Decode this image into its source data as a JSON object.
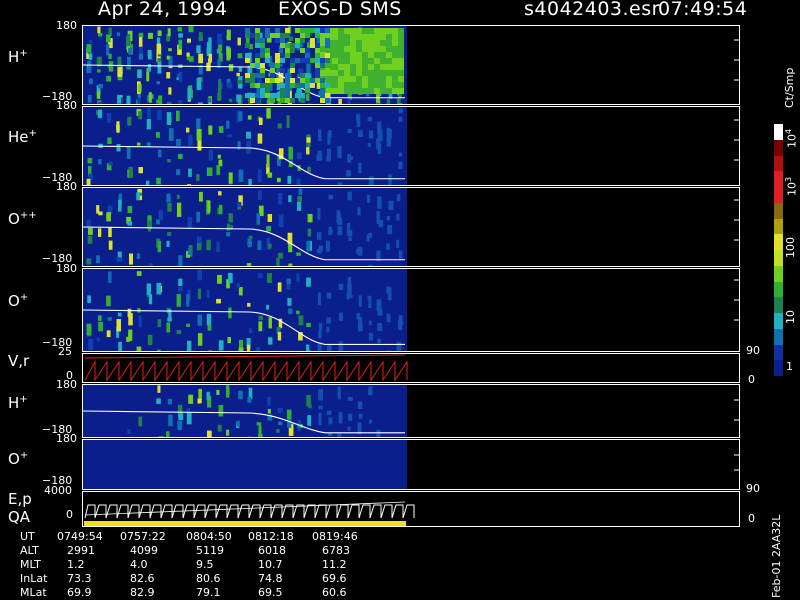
{
  "header": {
    "date": "Apr 24, 1994",
    "instrument": "EXOS-D SMS",
    "file": "s4042403.esr",
    "time": "07:49:54"
  },
  "colors": {
    "background": "#000000",
    "spectrogram_bg": "#0a1e8c",
    "frame": "#ffffff",
    "curve": "#ffffff",
    "vr_trace": "#e02020",
    "qa_bar": "#f0e020"
  },
  "colorbar": {
    "unit": "Ct/Smp",
    "tick_labels": [
      "1",
      "10",
      "100",
      "10",
      "10"
    ],
    "exponent_labels": [
      "3",
      "4"
    ],
    "colors": [
      "#ffffff",
      "#7a0000",
      "#b01010",
      "#e02020",
      "#e02020",
      "#8a6a10",
      "#b0a010",
      "#e0e030",
      "#c0e020",
      "#70d020",
      "#30b030",
      "#208050",
      "#20b0c0",
      "#1070b0",
      "#1030a0",
      "#0a1e8c"
    ]
  },
  "panels": [
    {
      "label": "H",
      "charge": "+",
      "ymax": "180",
      "ymin": "−180"
    },
    {
      "label": "He",
      "charge": "+",
      "ymax": "180",
      "ymin": "−180"
    },
    {
      "label": "O",
      "charge": "++",
      "ymax": "180",
      "ymin": "−180"
    },
    {
      "label": "O",
      "charge": "+",
      "ymax": "180",
      "ymin": "−180"
    },
    {
      "label": "V,r",
      "charge": "",
      "ymax": "25",
      "ymin": "0",
      "right_top": "90",
      "right_bottom": "0"
    },
    {
      "label": "H",
      "charge": "+",
      "ymax": "180",
      "ymin": "−180"
    },
    {
      "label": "O",
      "charge": "+",
      "ymax": "180",
      "ymin": "−180"
    },
    {
      "label": "E,p",
      "label2": "QA",
      "ymax": "4000",
      "ymin": "0",
      "right_top": "90",
      "right_bottom": "0"
    }
  ],
  "footer": {
    "row_labels": [
      "UT",
      "ALT",
      "MLT",
      "InLat",
      "MLat"
    ],
    "columns": [
      [
        "0749:54",
        "2991",
        "1.2",
        "73.3",
        "69.9"
      ],
      [
        "0757:22",
        "4099",
        "4.0",
        "82.6",
        "82.9"
      ],
      [
        "0804:50",
        "5119",
        "9.5",
        "80.6",
        "79.1"
      ],
      [
        "0812:18",
        "6018",
        "10.7",
        "74.8",
        "69.5"
      ],
      [
        "0819:46",
        "6783",
        "11.2",
        "69.6",
        "60.6"
      ]
    ],
    "side_text": "Feb-01 2AA32L"
  },
  "chart_data": {
    "type": "heatmap",
    "title": "Apr 24, 1994   EXOS-D SMS",
    "xlabel": "UT",
    "x_ticks": [
      "0749:54",
      "0757:22",
      "0804:50",
      "0812:18",
      "0819:46"
    ],
    "colorbar_unit": "Ct/Smp",
    "colorbar_ticks": [
      "1",
      "10",
      "100",
      "10^3",
      "10^4"
    ],
    "panels": [
      {
        "name": "H+",
        "ylim": [
          -180,
          180
        ]
      },
      {
        "name": "He+",
        "ylim": [
          -180,
          180
        ]
      },
      {
        "name": "O++",
        "ylim": [
          -180,
          180
        ]
      },
      {
        "name": "O+",
        "ylim": [
          -180,
          180
        ]
      },
      {
        "name": "V,r",
        "ylim": [
          0,
          25
        ],
        "right_ylim": [
          0,
          90
        ]
      },
      {
        "name": "H+",
        "ylim": [
          -180,
          180
        ]
      },
      {
        "name": "O+",
        "ylim": [
          -180,
          180
        ]
      },
      {
        "name": "E,p / QA",
        "ylim": [
          0,
          4000
        ],
        "right_ylim": [
          0,
          90
        ]
      }
    ]
  }
}
